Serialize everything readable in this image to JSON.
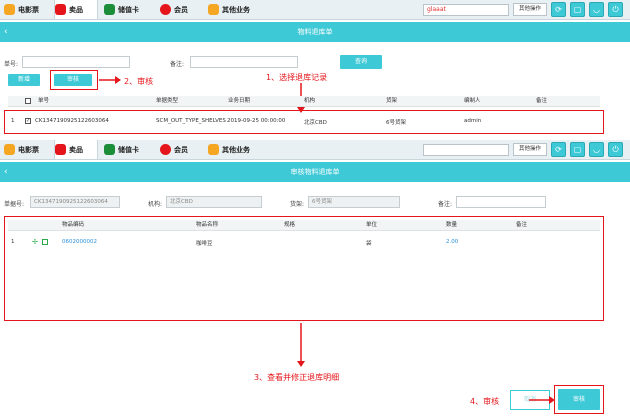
{
  "top_tabs": [
    {
      "label": "电影票",
      "icon": "popcorn-icon",
      "color": "#f5a623"
    },
    {
      "label": "卖品",
      "icon": "snack-icon",
      "color": "#e4161b"
    },
    {
      "label": "储值卡",
      "icon": "card-icon",
      "color": "#1c8e3a"
    },
    {
      "label": "会员",
      "icon": "heart-icon",
      "color": "#e4161b"
    },
    {
      "label": "其他业务",
      "icon": "folder-icon",
      "color": "#f5a623"
    }
  ],
  "user_field": "glaaat",
  "other_ops": "其他操作",
  "screen1": {
    "title": "物料退库单",
    "doc_no_label": "单号:",
    "remark_label": "备注:",
    "query_btn": "查询",
    "add_btn": "新增",
    "audit_btn": "审核",
    "columns": [
      "单号",
      "单据类型",
      "业务日期",
      "机构",
      "货架",
      "编制人",
      "备注"
    ],
    "rows": [
      {
        "idx": "1",
        "doc_no": "CK1347190925122603064",
        "type": "SCM_OUT_TYPE_SHELVES",
        "date": "2019-09-25 00:00:00",
        "org": "北京CBD",
        "shelf": "6号货架",
        "maker": "admin",
        "remark": ""
      }
    ]
  },
  "screen2": {
    "title": "审核物料退库单",
    "doc_no_label": "单据号:",
    "doc_no_value": "CK1347190925122603064",
    "org_label": "机构:",
    "org_value": "北京CBD",
    "shelf_label": "货架:",
    "shelf_value": "6号货架",
    "remark_label": "备注:",
    "columns": [
      "物品编码",
      "物品名称",
      "规格",
      "单位",
      "数量",
      "备注"
    ],
    "rows": [
      {
        "idx": "1",
        "code": "0602000002",
        "name": "咖啡豆",
        "spec": "",
        "unit": "袋",
        "qty": "2.00",
        "remark": ""
      }
    ],
    "cancel_btn": "取消",
    "audit_btn": "审核"
  },
  "annotations": {
    "a1": "1、选择退库记录",
    "a2": "2、审核",
    "a3": "3、查看并修正退库明细",
    "a4": "4、审核"
  },
  "colors": {
    "accent": "#3ec9d6",
    "annotation": "#e4161b",
    "link": "#2a8fd9"
  }
}
